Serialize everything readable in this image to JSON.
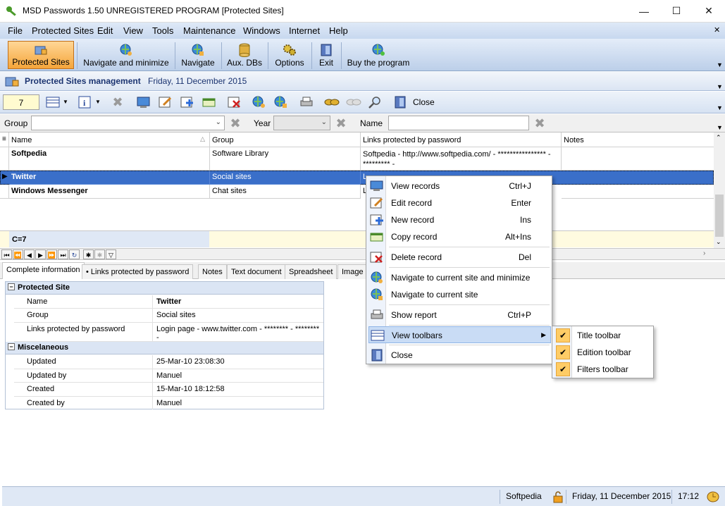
{
  "window": {
    "title": "MSD Passwords 1.50 UNREGISTERED PROGRAM [Protected Sites]"
  },
  "menubar": [
    "File",
    "Protected Sites",
    "Edit",
    "View",
    "Tools",
    "Maintenance",
    "Windows",
    "Internet",
    "Help"
  ],
  "main_toolbar": {
    "protected_sites": "Protected Sites",
    "navigate_minimize": "Navigate and minimize",
    "navigate": "Navigate",
    "aux_dbs": "Aux. DBs",
    "options": "Options",
    "exit": "Exit",
    "buy": "Buy the program"
  },
  "header": {
    "title": "Protected Sites management",
    "date": "Friday, 11 December 2015"
  },
  "record_toolbar": {
    "count": "7",
    "close": "Close"
  },
  "filters": {
    "group_label": "Group",
    "year_label": "Year",
    "name_label": "Name"
  },
  "grid": {
    "columns": [
      "Name",
      "Group",
      "Links protected by password",
      "Notes"
    ],
    "rows": [
      {
        "name": "Softpedia",
        "group": "Software Library",
        "links": "Softpedia - http://www.softpedia.com/ - **************** - ********* -"
      },
      {
        "name": "Twitter",
        "group": "Social sites",
        "links": "L"
      },
      {
        "name": "Windows Messenger",
        "group": "Chat sites",
        "links": "L"
      }
    ],
    "footer": "C=7"
  },
  "tabs": [
    "Complete information",
    "Links protected by password",
    "Notes",
    "Text document",
    "Spreadsheet",
    "Image"
  ],
  "detail": {
    "section1": "Protected Site",
    "name_label": "Name",
    "name_value": "Twitter",
    "group_label": "Group",
    "group_value": "Social sites",
    "links_label": "Links protected by password",
    "links_value": "Login page - www.twitter.com - ******** - ******** -",
    "section2": "Miscelaneous",
    "updated_label": "Updated",
    "updated_value": "25-Mar-10 23:08:30",
    "updatedby_label": "Updated by",
    "updatedby_value": "Manuel",
    "created_label": "Created",
    "created_value": "15-Mar-10 18:12:58",
    "createdby_label": "Created by",
    "createdby_value": "Manuel"
  },
  "context_menu": {
    "view_records": "View records",
    "view_records_acc": "Ctrl+J",
    "edit_record": "Edit record",
    "edit_record_acc": "Enter",
    "new_record": "New record",
    "new_record_acc": "Ins",
    "copy_record": "Copy record",
    "copy_record_acc": "Alt+Ins",
    "delete_record": "Delete record",
    "delete_record_acc": "Del",
    "nav_min": "Navigate to current site and minimize",
    "nav": "Navigate to current site",
    "show_report": "Show report",
    "show_report_acc": "Ctrl+P",
    "view_toolbars": "View toolbars",
    "close": "Close"
  },
  "submenu": {
    "title_toolbar": "Title toolbar",
    "edition_toolbar": "Edition toolbar",
    "filters_toolbar": "Filters toolbar"
  },
  "statusbar": {
    "softpedia": "Softpedia",
    "date": "Friday, 11 December 2015",
    "time": "17:12"
  },
  "colors": {
    "selection": "#3a6fc9",
    "accent": "#f5a53a",
    "toolbar": "#c7d8ef"
  }
}
